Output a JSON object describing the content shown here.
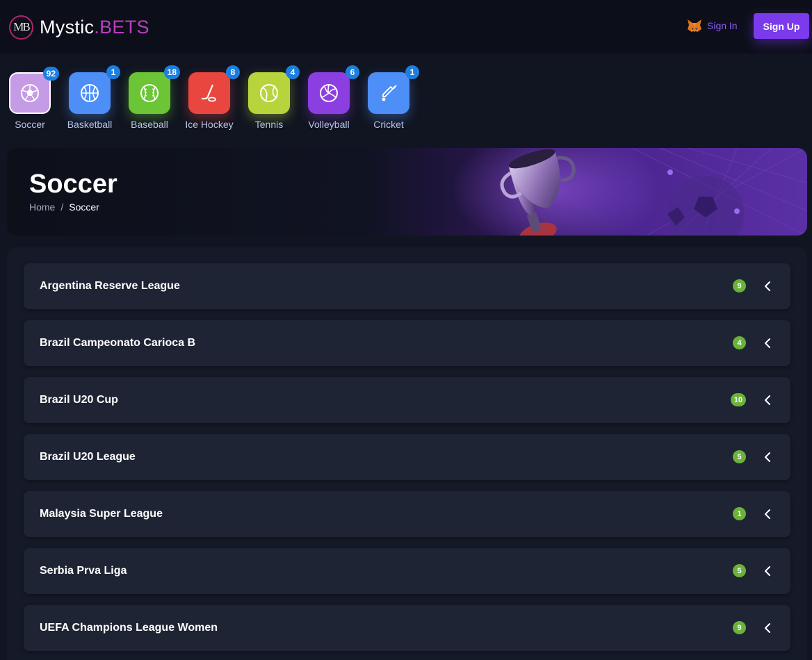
{
  "header": {
    "logo_initials": "MB",
    "logo_word": "Mystic",
    "logo_accent": ".BETS",
    "sign_in_label": "Sign In",
    "sign_up_label": "Sign Up"
  },
  "sports": [
    {
      "label": "Soccer",
      "count": "92",
      "icon": "soccer-ball-icon",
      "color": "#c59be6"
    },
    {
      "label": "Basketball",
      "count": "1",
      "icon": "basketball-icon",
      "color": "#4d8ef7"
    },
    {
      "label": "Baseball",
      "count": "18",
      "icon": "baseball-icon",
      "color": "#6cc534"
    },
    {
      "label": "Ice Hockey",
      "count": "8",
      "icon": "hockey-stick-icon",
      "color": "#e8463e"
    },
    {
      "label": "Tennis",
      "count": "4",
      "icon": "tennis-ball-icon",
      "color": "#b8d43d"
    },
    {
      "label": "Volleyball",
      "count": "6",
      "icon": "volleyball-icon",
      "color": "#8c3fe0"
    },
    {
      "label": "Cricket",
      "count": "1",
      "icon": "cricket-bat-icon",
      "color": "#4d8ef7"
    }
  ],
  "banner": {
    "title": "Soccer",
    "breadcrumb_home": "Home",
    "breadcrumb_sep": "/",
    "breadcrumb_current": "Soccer"
  },
  "leagues": [
    {
      "name": "Argentina Reserve League",
      "count": "9"
    },
    {
      "name": "Brazil Campeonato Carioca B",
      "count": "4"
    },
    {
      "name": "Brazil U20 Cup",
      "count": "10"
    },
    {
      "name": "Brazil U20 League",
      "count": "5"
    },
    {
      "name": "Malaysia Super League",
      "count": "1"
    },
    {
      "name": "Serbia Prva Liga",
      "count": "5"
    },
    {
      "name": "UEFA Champions League Women",
      "count": "9"
    }
  ],
  "colors": {
    "accent": "#7c3aed",
    "badge_blue": "#1c7fe0",
    "count_green": "#6ab33a"
  }
}
